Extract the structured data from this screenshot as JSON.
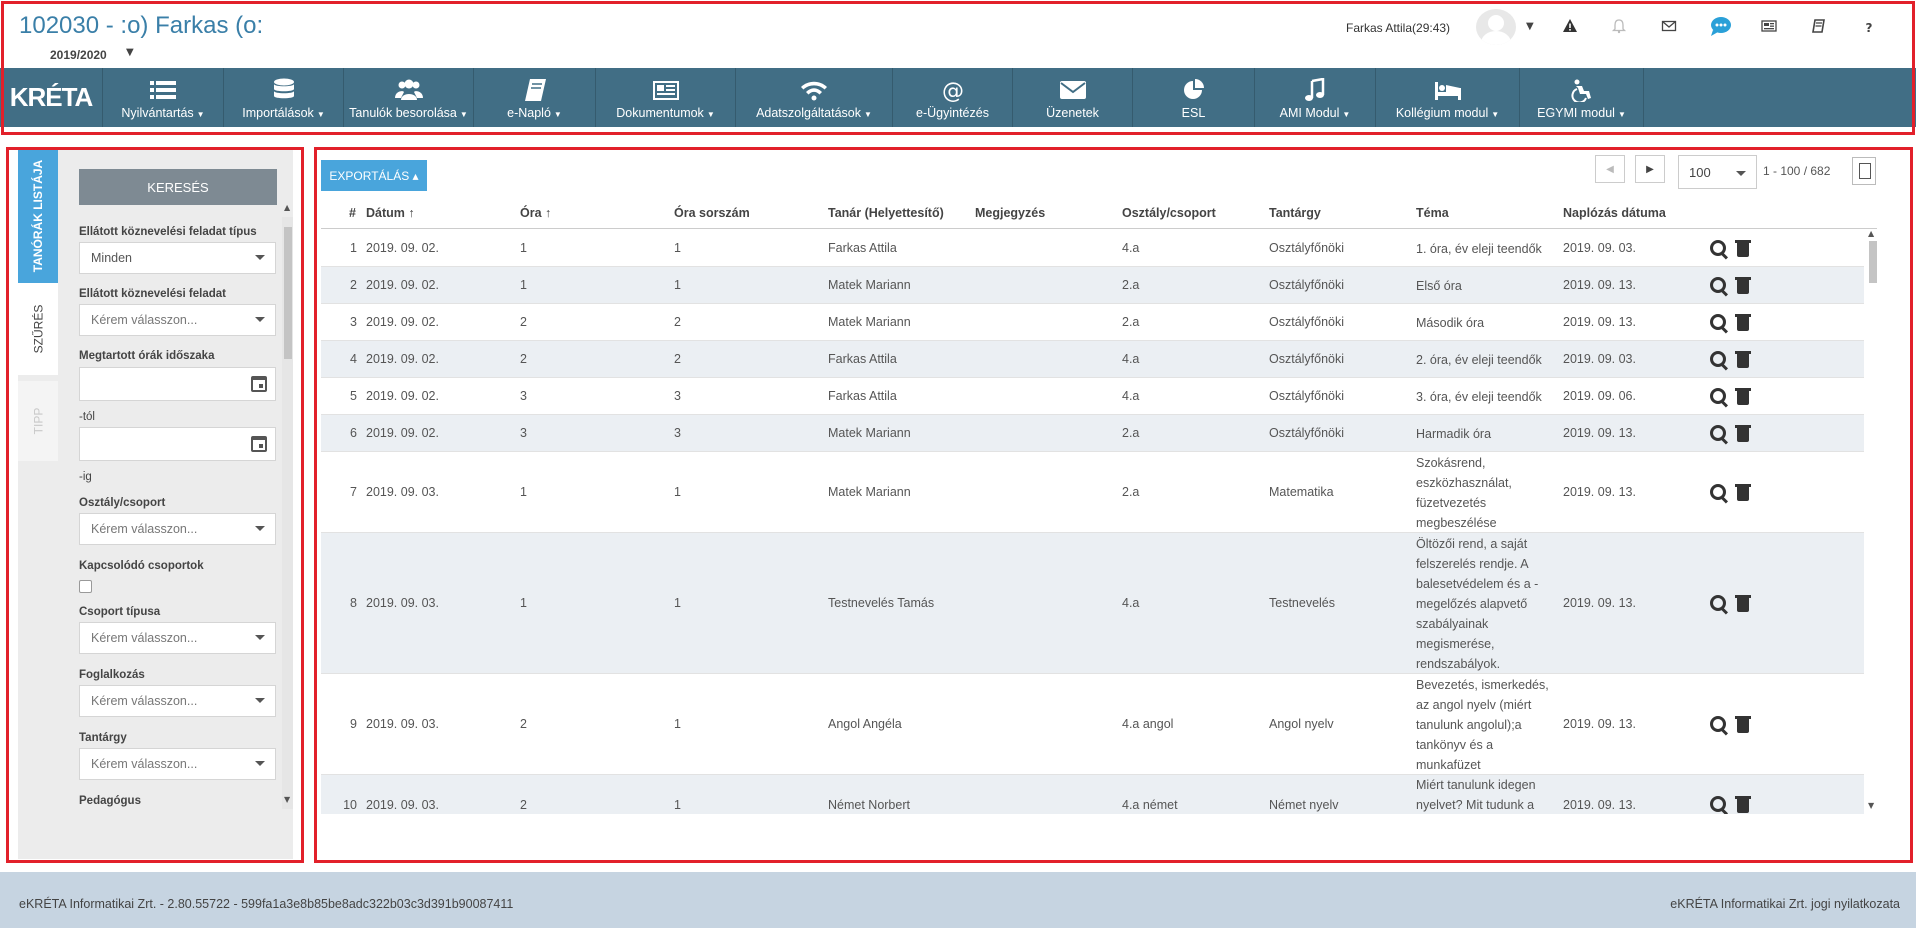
{
  "header": {
    "title": "102030 - :o) Farkas (o:",
    "year": "2019/2020",
    "user": "Farkas Attila(29:43)"
  },
  "header_icons": [
    "warning-icon",
    "bell-icon",
    "mail-icon",
    "chat-icon",
    "news-icon",
    "book-icon",
    "help-icon"
  ],
  "help_glyph": "?",
  "logo_text": "KRÉTA",
  "nav": {
    "items": [
      {
        "label": "Nyilvántartás",
        "caret": true,
        "icon": "list-icon"
      },
      {
        "label": "Importálások",
        "caret": true,
        "icon": "database-icon"
      },
      {
        "label": "Tanulók besorolása",
        "caret": true,
        "icon": "users-icon"
      },
      {
        "label": "e-Napló",
        "caret": true,
        "icon": "book-icon"
      },
      {
        "label": "Dokumentumok",
        "caret": true,
        "icon": "newspaper-icon"
      },
      {
        "label": "Adatszolgáltatások",
        "caret": true,
        "icon": "wifi-icon"
      },
      {
        "label": "e-Ügyintézés",
        "caret": false,
        "icon": "at-icon"
      },
      {
        "label": "Üzenetek",
        "caret": false,
        "icon": "envelope-icon"
      },
      {
        "label": "ESL",
        "caret": false,
        "icon": "pie-chart-icon"
      },
      {
        "label": "AMI Modul",
        "caret": true,
        "icon": "music-icon"
      },
      {
        "label": "Kollégium modul",
        "caret": true,
        "icon": "bed-icon"
      },
      {
        "label": "EGYMI modul",
        "caret": true,
        "icon": "accessibility-icon"
      }
    ]
  },
  "sidebar": {
    "tabs": {
      "list": "TANÓRÁK LISTÁJA",
      "filter": "SZŰRÉS",
      "tip": "TIPP"
    },
    "search_button": "KERESÉS",
    "filters": {
      "task_type_label": "Ellátott köznevelési feladat típus",
      "task_type_value": "Minden",
      "task_label": "Ellátott köznevelési feladat",
      "task_value": "Kérem válasszon...",
      "period_label": "Megtartott órák időszaka",
      "from_label": "-tól",
      "to_label": "-ig",
      "class_label": "Osztály/csoport",
      "class_value": "Kérem válasszon...",
      "related_label": "Kapcsolódó csoportok",
      "group_type_label": "Csoport típusa",
      "group_type_value": "Kérem válasszon...",
      "occupation_label": "Foglalkozás",
      "occupation_value": "Kérem válasszon...",
      "subject_label": "Tantárgy",
      "subject_value": "Kérem válasszon...",
      "teacher_label": "Pedagógus"
    }
  },
  "main": {
    "export_button": "EXPORTÁLÁS",
    "page_size": "100",
    "page_info": "1 - 100 / 682",
    "columns": {
      "num": "#",
      "date": "Dátum",
      "lesson": "Óra",
      "lesson_no": "Óra sorszám",
      "teacher": "Tanár (Helyettesítő)",
      "note": "Megjegyzés",
      "class": "Osztály/csoport",
      "subject": "Tantárgy",
      "topic": "Téma",
      "logged": "Naplózás dátuma"
    },
    "sort_arrow": "↑",
    "rows": [
      {
        "num": "1",
        "date": "2019. 09. 02.",
        "lesson": "1",
        "lesson_no": "1",
        "teacher": "Farkas Attila",
        "class": "4.a",
        "subject": "Osztályfőnöki",
        "topic": "1. óra, év eleji teendők",
        "logged": "2019. 09. 03."
      },
      {
        "num": "2",
        "date": "2019. 09. 02.",
        "lesson": "1",
        "lesson_no": "1",
        "teacher": "Matek Mariann",
        "class": "2.a",
        "subject": "Osztályfőnöki",
        "topic": "Első óra",
        "logged": "2019. 09. 13."
      },
      {
        "num": "3",
        "date": "2019. 09. 02.",
        "lesson": "2",
        "lesson_no": "2",
        "teacher": "Matek Mariann",
        "class": "2.a",
        "subject": "Osztályfőnöki",
        "topic": "Második óra",
        "logged": "2019. 09. 13."
      },
      {
        "num": "4",
        "date": "2019. 09. 02.",
        "lesson": "2",
        "lesson_no": "2",
        "teacher": "Farkas Attila",
        "class": "4.a",
        "subject": "Osztályfőnöki",
        "topic": "2. óra, év eleji teendők",
        "logged": "2019. 09. 03."
      },
      {
        "num": "5",
        "date": "2019. 09. 02.",
        "lesson": "3",
        "lesson_no": "3",
        "teacher": "Farkas Attila",
        "class": "4.a",
        "subject": "Osztályfőnöki",
        "topic": "3. óra, év eleji teendők",
        "logged": "2019. 09. 06."
      },
      {
        "num": "6",
        "date": "2019. 09. 02.",
        "lesson": "3",
        "lesson_no": "3",
        "teacher": "Matek Mariann",
        "class": "2.a",
        "subject": "Osztályfőnöki",
        "topic": "Harmadik óra",
        "logged": "2019. 09. 13."
      },
      {
        "num": "7",
        "date": "2019. 09. 03.",
        "lesson": "1",
        "lesson_no": "1",
        "teacher": "Matek Mariann",
        "class": "2.a",
        "subject": "Matematika",
        "topic": "Szokásrend, eszközhasználat, füzetvezetés megbeszélése",
        "logged": "2019. 09. 13."
      },
      {
        "num": "8",
        "date": "2019. 09. 03.",
        "lesson": "1",
        "lesson_no": "1",
        "teacher": "Testnevelés Tamás",
        "class": "4.a",
        "subject": "Testnevelés",
        "topic": "Öltözői rend, a saját felszerelés rendje. A balesetvédelem és a -megelőzés alapvető szabályainak megismerése, rendszabályok.",
        "logged": "2019. 09. 13."
      },
      {
        "num": "9",
        "date": "2019. 09. 03.",
        "lesson": "2",
        "lesson_no": "1",
        "teacher": "Angol Angéla",
        "class": "4.a angol",
        "subject": "Angol nyelv",
        "topic": "Bevezetés, ismerkedés, az angol nyelv (miért tanulunk angolul);a tankönyv és a munkafüzet",
        "logged": "2019. 09. 13."
      },
      {
        "num": "10",
        "date": "2019. 09. 03.",
        "lesson": "2",
        "lesson_no": "1",
        "teacher": "Német Norbert",
        "class": "4.a német",
        "subject": "Német nyelv",
        "topic": "Miért tanulunk idegen nyelvet? Mit tudunk a",
        "logged": "2019. 09. 13."
      }
    ]
  },
  "footer": {
    "left": "eKRÉTA Informatikai Zrt. - 2.80.55722 - 599fa1a3e8b85be8adc322b03c3d391b90087411",
    "right": "eKRÉTA Informatikai Zrt. jogi nyilatkozata"
  },
  "colors": {
    "nav_bg": "#416e85",
    "accent": "#49a5dc",
    "frame": "#e2202a",
    "footer_bg": "#c6d4e1"
  }
}
